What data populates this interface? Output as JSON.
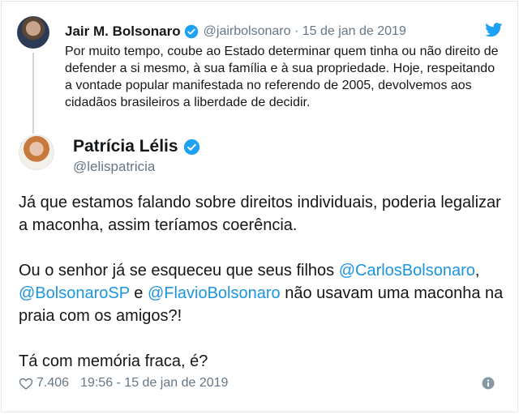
{
  "parent_tweet": {
    "name": "Jair M. Bolsonaro",
    "handle": "@jairbolsonaro",
    "separator": "·",
    "date": "15 de jan de 2019",
    "text": "Por muito tempo, coube ao Estado determinar quem tinha ou não direito de defender a si mesmo, à sua família e à sua propriedade. Hoje, respeitando a vontade popular manifestada no referendo de 2005, devolvemos aos cidadãos brasileiros a liberdade de decidir."
  },
  "main_tweet": {
    "name": "Patrícia Lélis",
    "handle": "@lelispatricia",
    "paragraph1": "Já que estamos falando sobre direitos individuais, poderia legalizar a maconha, assim teríamos coerência.",
    "paragraph2_prefix": "Ou o senhor já se esqueceu que seus filhos ",
    "mention1": "@CarlosBolsonaro",
    "comma": ",",
    "mention2": "@BolsonaroSP",
    "and": " e ",
    "mention3": "@FlavioBolsonaro",
    "paragraph2_suffix": " não usavam uma maconha na praia com os amigos?!",
    "paragraph3": "Tá com memória fraca, é?"
  },
  "footer": {
    "likes": "7.406",
    "timestamp": "19:56 - 15 de jan de 2019"
  },
  "icons": {
    "brand": "twitter-bird-icon",
    "verified": "verified-badge-icon",
    "like": "heart-icon",
    "info": "info-icon"
  },
  "colors": {
    "link": "#1b95e0",
    "verified": "#1da1f2",
    "secondary_text": "#657786",
    "primary_text": "#14171a"
  }
}
